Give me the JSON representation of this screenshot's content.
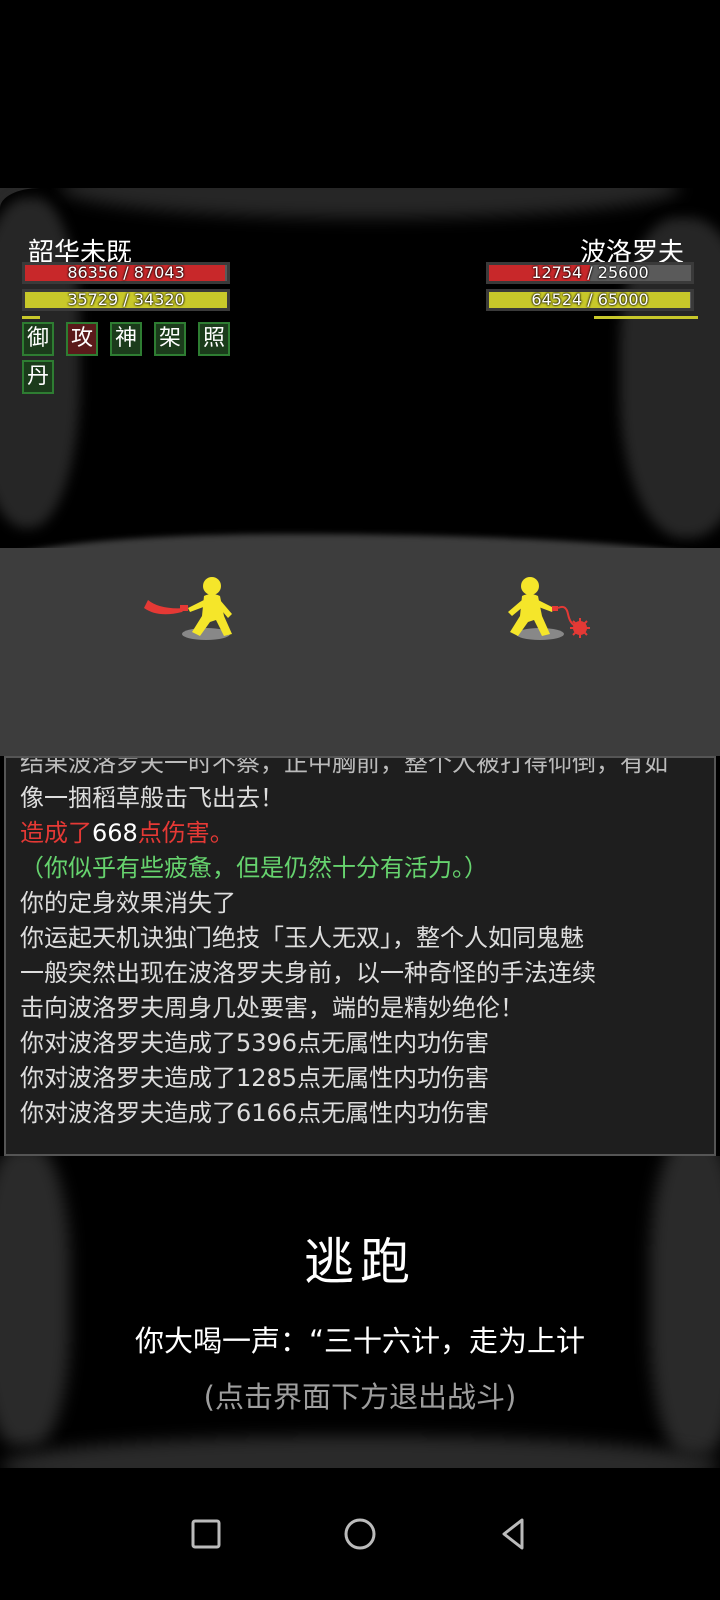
{
  "player": {
    "name": "韶华未既",
    "hp": {
      "text": "86356 / 87043",
      "ratio": 0.992
    },
    "mp": {
      "text": "35729 / 34320",
      "ratio": 1.0
    },
    "buffs": [
      {
        "label": "御",
        "kind": "defense"
      },
      {
        "label": "攻",
        "kind": "attack"
      },
      {
        "label": "神",
        "kind": "spirit"
      },
      {
        "label": "架",
        "kind": "parry"
      },
      {
        "label": "照",
        "kind": "reflect"
      },
      {
        "label": "丹",
        "kind": "pill"
      }
    ]
  },
  "enemy": {
    "name": "波洛罗夫",
    "hp": {
      "text": "12754 / 25600",
      "ratio": 0.498
    },
    "mp": {
      "text": "64524 / 65000",
      "ratio": 0.993
    }
  },
  "log": {
    "clipped_line": "结果波洛罗夫一时不察，正中胸前，整个人被打得仰倒，有如",
    "lines": [
      {
        "text": "像一捆稻草般击飞出去！"
      },
      {
        "pre": "造成了",
        "num": "668",
        "post": "点伤害。"
      },
      {
        "text": "（你似乎有些疲惫，但是仍然十分有活力。）",
        "color": "green"
      },
      {
        "text": "你的定身效果消失了"
      },
      {
        "text": "你运起天机诀独门绝技「玉人无双」，整个人如同鬼魅"
      },
      {
        "text": "一般突然出现在波洛罗夫身前，以一种奇怪的手法连续"
      },
      {
        "text": "击向波洛罗夫周身几处要害，端的是精妙绝伦！"
      },
      {
        "text": "你对波洛罗夫造成了5396点无属性内功伤害"
      },
      {
        "text": "你对波洛罗夫造成了1285点无属性内功伤害"
      },
      {
        "text": "你对波洛罗夫造成了6166点无属性内功伤害"
      }
    ]
  },
  "escape": {
    "title": "逃跑",
    "shout": "你大喝一声：“三十六计，走为上计",
    "hint": "(点击界面下方退出战斗)"
  },
  "navbar": {
    "icons": [
      "recent-apps-icon",
      "home-icon",
      "back-icon"
    ]
  },
  "colors": {
    "hp": "#c8282a",
    "mp": "#c8c82a",
    "fighter": "#f5e62a",
    "damage_red": "#e53935",
    "status_green": "#66d36e"
  }
}
